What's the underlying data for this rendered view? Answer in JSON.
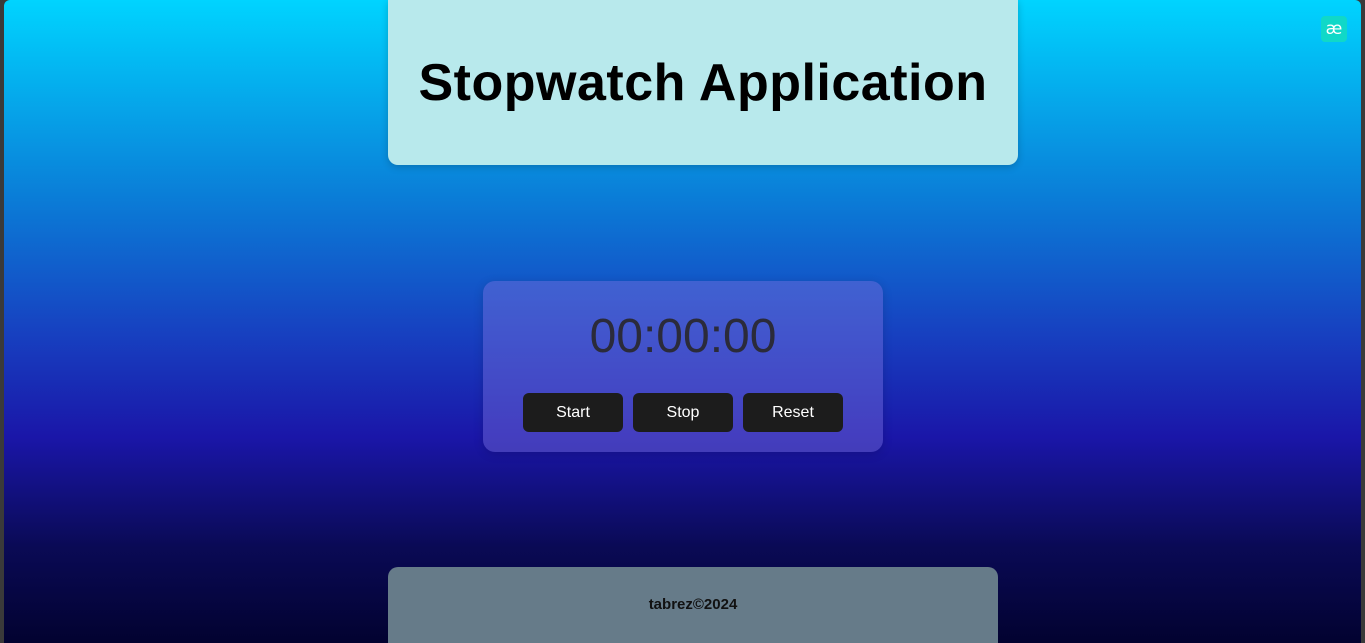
{
  "header": {
    "title": "Stopwatch Application"
  },
  "badge": {
    "glyph": "æ",
    "icon": "extension-badge-icon",
    "color": "#10d8c8"
  },
  "stopwatch": {
    "time": "00:00:00",
    "buttons": {
      "start": "Start",
      "stop": "Stop",
      "reset": "Reset"
    }
  },
  "footer": {
    "text": "tabrez©2024"
  },
  "colors": {
    "gradient_top": "#00d4ff",
    "gradient_bottom": "#020230",
    "header_bg": "#b8e9ec",
    "button_bg": "#1c1c1c",
    "footer_bg": "#667b89"
  }
}
